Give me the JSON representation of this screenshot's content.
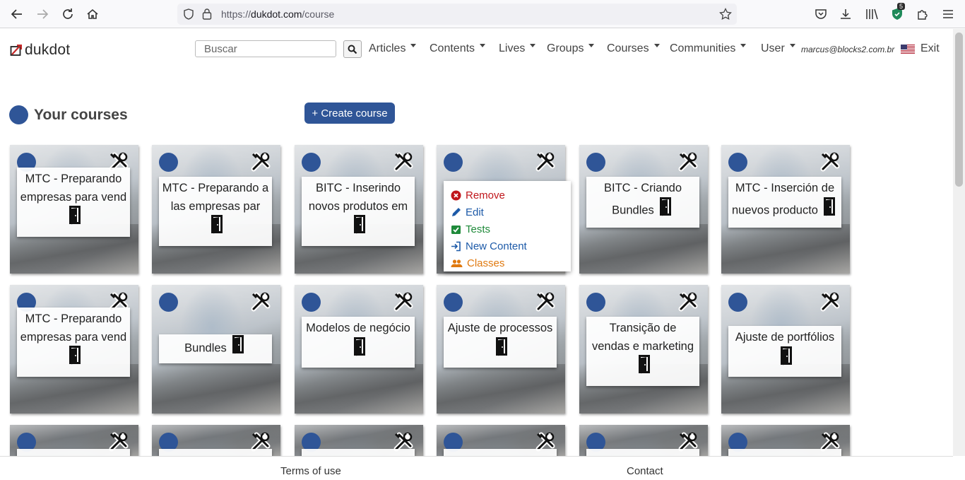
{
  "browser": {
    "url_prefix": "https://",
    "url_host": "dukdot.com",
    "url_path": "/course",
    "extension_badge": "5"
  },
  "nav": {
    "logo_text": "dukdot",
    "search_placeholder": "Buscar",
    "menu": [
      "Articles",
      "Contents",
      "Lives",
      "Groups",
      "Courses",
      "Communities",
      "User"
    ],
    "user_email": "marcus@blocks2.com.br",
    "exit_label": "Exit"
  },
  "header": {
    "title": "Your courses",
    "create_button": "+ Create course"
  },
  "context_menu": {
    "items": [
      {
        "label": "Remove",
        "color": "#c0161b",
        "icon": "remove-icon"
      },
      {
        "label": "Edit",
        "color": "#1d5aa8",
        "icon": "pencil-icon"
      },
      {
        "label": "Tests",
        "color": "#1f8a3a",
        "icon": "check-clipboard-icon"
      },
      {
        "label": "New Content",
        "color": "#1d5aa8",
        "icon": "enter-icon"
      },
      {
        "label": "Classes",
        "color": "#e07a10",
        "icon": "users-icon"
      }
    ]
  },
  "courses": [
    {
      "title": "MTC - Preparando empresas para vend"
    },
    {
      "title": "MTC - Preparando a las empresas par"
    },
    {
      "title": "BITC - Inserindo novos produtos em"
    },
    {
      "title": ""
    },
    {
      "title": "BITC - Criando Bundles"
    },
    {
      "title": "MTC - Inserción de nuevos producto"
    },
    {
      "title": "MTC - Preparando empresas para vend"
    },
    {
      "title": "Bundles"
    },
    {
      "title": "Modelos de negócio"
    },
    {
      "title": "Ajuste de processos"
    },
    {
      "title": "Transição de vendas e marketing"
    },
    {
      "title": "Ajuste de portfólios"
    }
  ],
  "footer": {
    "terms": "Terms of use",
    "contact": "Contact"
  }
}
